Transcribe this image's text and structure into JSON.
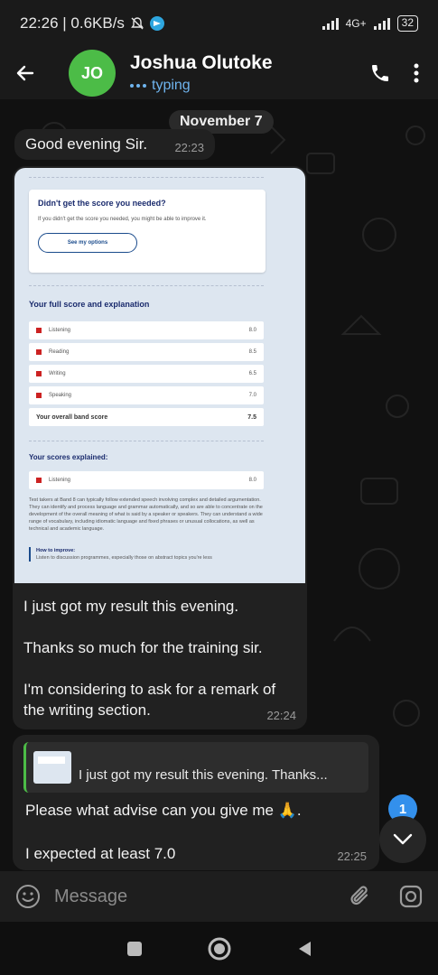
{
  "status_bar": {
    "time_speed": "22:26 | 0.6KB/s",
    "network": "4G+",
    "battery": "32"
  },
  "header": {
    "avatar_initials": "JO",
    "contact_name": "Joshua Olutoke",
    "status": "typing",
    "avatar_color": "#4cbc47",
    "status_color": "#6fb4ee"
  },
  "chat": {
    "date_label": "November 7",
    "messages": [
      {
        "text": "Good evening Sir.",
        "time": "22:23"
      },
      {
        "image": {
          "card_title": "Didn't get the score you needed?",
          "card_sub": "If you didn't get the score you needed, you might be able to improve it.",
          "card_button": "See my options",
          "full_score_title": "Your full score and explanation",
          "scores": [
            {
              "skill": "Listening",
              "score": "8.0"
            },
            {
              "skill": "Reading",
              "score": "8.5"
            },
            {
              "skill": "Writing",
              "score": "6.5"
            },
            {
              "skill": "Speaking",
              "score": "7.0"
            }
          ],
          "overall_label": "Your overall band score",
          "overall_score": "7.5",
          "explained_title": "Your scores explained:",
          "explained_skill": "Listening",
          "explained_score": "8.0",
          "explained_text": "Test takers at Band 8 can typically follow extended speech involving complex and detailed argumentation. They can identify and process language and grammar automatically, and so are able to concentrate on the development of the overall meaning of what is said by a speaker or speakers. They can understand a wide range of vocabulary, including idiomatic language and fixed phrases or unusual collocations, as well as technical and academic language.",
          "improve_title": "How to improve:",
          "improve_text": "Listen to discussion programmes, especially those on abstract topics you're less"
        },
        "text": "I just got my result this evening.\n\nThanks so much for the training sir.\n\nI'm considering to ask for a remark of the writing section.",
        "time": "22:24"
      },
      {
        "reply_preview": "I just got my result this evening.  Thanks...",
        "text": "Please what advise can you give me 🙏.\n\nI expected at least 7.0",
        "time": "22:25"
      }
    ],
    "unread_count": "1"
  },
  "composer": {
    "placeholder": "Message"
  }
}
